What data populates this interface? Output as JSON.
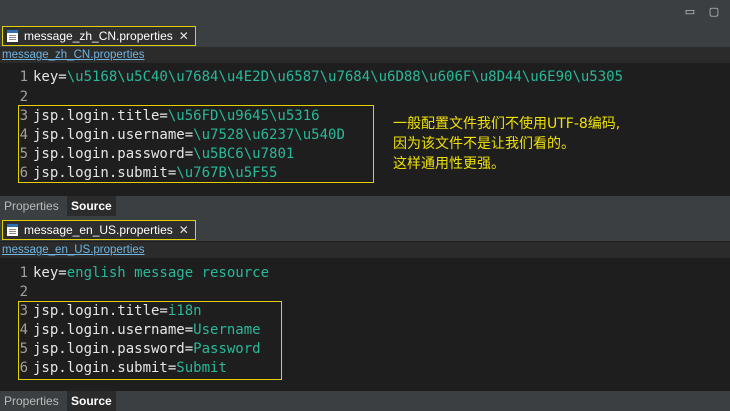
{
  "top_editor": {
    "tab_label": "message_zh_CN.properties",
    "breadcrumb": "message_zh_CN.properties",
    "lines": [
      {
        "num": "1",
        "key": "key=",
        "value": "\\u5168\\u5C40\\u7684\\u4E2D\\u6587\\u7684\\u6D88\\u606F\\u8D44\\u6E90\\u5305"
      },
      {
        "num": "2",
        "key": "",
        "value": ""
      },
      {
        "num": "3",
        "key": "jsp.login.title=",
        "value": "\\u56FD\\u9645\\u5316"
      },
      {
        "num": "4",
        "key": "jsp.login.username=",
        "value": "\\u7528\\u6237\\u540D"
      },
      {
        "num": "5",
        "key": "jsp.login.password=",
        "value": "\\u5BC6\\u7801"
      },
      {
        "num": "6",
        "key": "jsp.login.submit=",
        "value": "\\u767B\\u5F55"
      }
    ],
    "bottom_tabs": {
      "properties": "Properties",
      "source": "Source"
    }
  },
  "annotation": {
    "lines": [
      "一般配置文件我们不使用UTF-8编码,",
      "因为该文件不是让我们看的。",
      "这样通用性更强。"
    ],
    "color": "#f0e000"
  },
  "bottom_editor": {
    "tab_label": "message_en_US.properties",
    "breadcrumb": "message_en_US.properties",
    "lines": [
      {
        "num": "1",
        "key": "key=",
        "value": "english message resource"
      },
      {
        "num": "2",
        "key": "",
        "value": ""
      },
      {
        "num": "3",
        "key": "jsp.login.title=",
        "value": "i18n"
      },
      {
        "num": "4",
        "key": "jsp.login.username=",
        "value": "Username"
      },
      {
        "num": "5",
        "key": "jsp.login.password=",
        "value": "Password"
      },
      {
        "num": "6",
        "key": "jsp.login.submit=",
        "value": "Submit"
      }
    ],
    "bottom_tabs": {
      "properties": "Properties",
      "source": "Source"
    }
  },
  "window_controls": {
    "minimize": "▭",
    "maximize": "▢"
  },
  "colors": {
    "key": "#e6e6e6",
    "value": "#28b89a",
    "highlight_border": "#e6d000",
    "link": "#6fb5e0"
  }
}
